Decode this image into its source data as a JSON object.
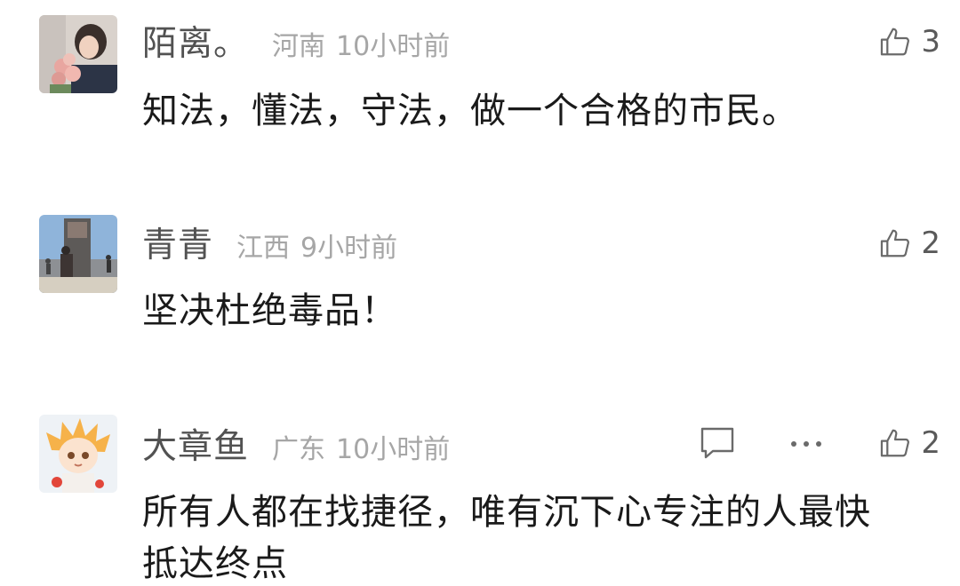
{
  "comments": [
    {
      "username": "陌离。",
      "location": "河南",
      "time": "10小时前",
      "text": "知法，懂法，守法，做一个合格的市民。",
      "likes": "3",
      "avatar_icon": "avatar-woman-with-flowers"
    },
    {
      "username": "青青",
      "location": "江西",
      "time": "9小时前",
      "text": "坚决杜绝毒品！",
      "likes": "2",
      "avatar_icon": "avatar-monument-photo"
    },
    {
      "username": "大章鱼",
      "location": "广东",
      "time": "10小时前",
      "text_line1": "所有人都在找捷径，唯有沉下心专注的人最快",
      "text_line2": "抵达终点",
      "likes": "2",
      "avatar_icon": "avatar-anime-character",
      "action_icons": [
        "reply-icon",
        "more-icon"
      ]
    }
  ],
  "colors": {
    "username": "#525252",
    "meta": "#a6a6a6",
    "text": "#1a1a1a",
    "icon": "#6a6a6a"
  }
}
